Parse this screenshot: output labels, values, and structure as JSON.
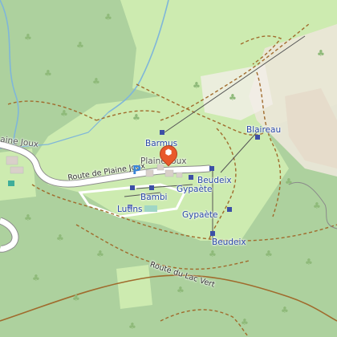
{
  "map": {
    "title": "",
    "labels": {
      "plaine_joux_corner": "aine Joux",
      "route_plaine_joux": "Route de Plaine Joux",
      "route_lac_vert": "Route du Lac Vert",
      "barmus": "Barmus",
      "plaine_joux": "Plaine Joux",
      "parking": "P",
      "blaireau": "Blaireau",
      "beudeix_top": "Beudeix",
      "gypaete_1": "Gypaète",
      "gypaete_2": "Gypaète",
      "bambi": "Bambi",
      "lutins": "Lutins",
      "beudeix_bottom": "Beudeix"
    },
    "colors": {
      "forest": "#add19e",
      "meadow": "#cdebb0",
      "ski_area": "#f2efe9",
      "track": "#a06b2d",
      "road": "#ffffff",
      "stream": "#7fb6d9",
      "lift": "#555555",
      "lift_stop": "#3c4fa6",
      "marker": "#e8592b",
      "parking": "#3a85d6"
    },
    "icons": {
      "marker": "location-pin-icon",
      "parking": "parking-icon",
      "tree": "tree-icon"
    }
  }
}
